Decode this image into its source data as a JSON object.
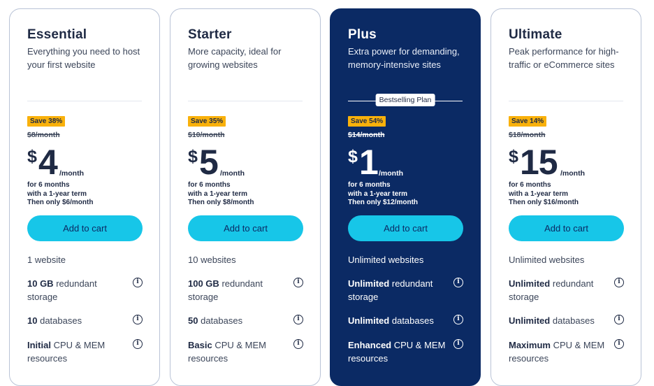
{
  "plans": [
    {
      "name": "Essential",
      "desc_line1": "Everything you need to host",
      "desc_line2": "your first website",
      "save": "Save 38%",
      "old_price": "$8/month",
      "currency": "$",
      "amount": "4",
      "per": "/month",
      "term1": "for 6 months",
      "term2": "with a 1-year term",
      "term3": "Then only $6/month",
      "cart": "Add to cart",
      "websites": "1 website",
      "storage_bold": "10 GB",
      "storage_rest": "redundant",
      "storage_line2": "storage",
      "db_bold": "10",
      "db_rest": "databases",
      "cpu_bold": "Initial",
      "cpu_rest": "CPU & MEM",
      "cpu_line2": "resources"
    },
    {
      "name": "Starter",
      "desc_line1": "More capacity, ideal for",
      "desc_line2": "growing websites",
      "save": "Save 35%",
      "old_price": "$10/month",
      "currency": "$",
      "amount": "5",
      "per": "/month",
      "term1": "for 6 months",
      "term2": "with a 1-year term",
      "term3": "Then only $8/month",
      "cart": "Add to cart",
      "websites": "10 websites",
      "storage_bold": "100 GB",
      "storage_rest": "redundant",
      "storage_line2": "storage",
      "db_bold": "50",
      "db_rest": "databases",
      "cpu_bold": "Basic",
      "cpu_rest": "CPU & MEM",
      "cpu_line2": "resources"
    },
    {
      "name": "Plus",
      "desc_line1": "Extra power for demanding,",
      "desc_line2": "memory-intensive sites",
      "badge": "Bestselling Plan",
      "save": "Save 54%",
      "old_price": "$14/month",
      "currency": "$",
      "amount": "1",
      "per": "/month",
      "term1": "for 6 months",
      "term2": "with a 1-year term",
      "term3": "Then only $12/month",
      "cart": "Add to cart",
      "websites": "Unlimited websites",
      "storage_bold": "Unlimited",
      "storage_rest": "redundant",
      "storage_line2": "storage",
      "db_bold": "Unlimited",
      "db_rest": "databases",
      "cpu_bold": "Enhanced",
      "cpu_rest": "CPU & MEM",
      "cpu_line2": "resources"
    },
    {
      "name": "Ultimate",
      "desc_line1": "Peak performance for high-",
      "desc_line2": "traffic or eCommerce sites",
      "save": "Save 14%",
      "old_price": "$18/month",
      "currency": "$",
      "amount": "15",
      "per": "/month",
      "term1": "for 6 months",
      "term2": "with a 1-year term",
      "term3": "Then only $16/month",
      "cart": "Add to cart",
      "websites": "Unlimited websites",
      "storage_bold": "Unlimited",
      "storage_rest": "redundant",
      "storage_line2": "storage",
      "db_bold": "Unlimited",
      "db_rest": "databases",
      "cpu_bold": "Maximum",
      "cpu_rest": "CPU & MEM",
      "cpu_line2": "resources"
    }
  ],
  "info_glyph": "i",
  "icons": {
    "info": "info-circle-icon"
  },
  "colors": {
    "featured_bg": "#0b2a64",
    "cta": "#17c6e8",
    "save_badge": "#f9b10b",
    "border": "#b9c3d6"
  }
}
